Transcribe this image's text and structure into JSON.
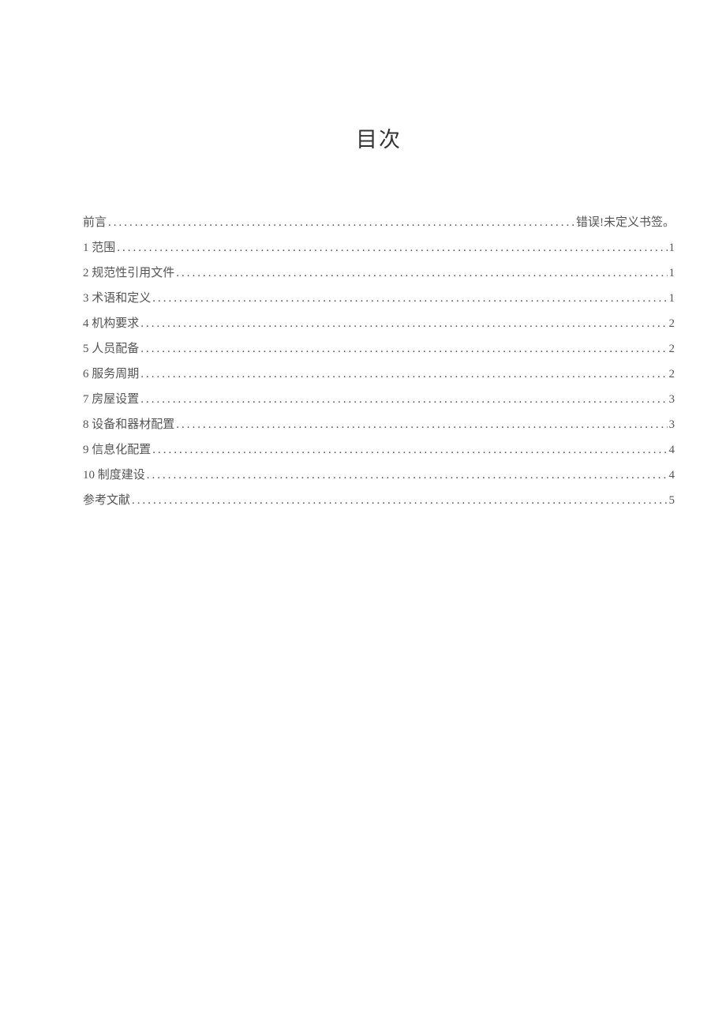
{
  "title": "目次",
  "toc": [
    {
      "label": "前言",
      "page": "错误!未定义书签。"
    },
    {
      "label": "1 范围",
      "page": "1"
    },
    {
      "label": "2 规范性引用文件",
      "page": "1"
    },
    {
      "label": "3 术语和定义",
      "page": "1"
    },
    {
      "label": "4 机构要求",
      "page": "2"
    },
    {
      "label": "5 人员配备",
      "page": "2"
    },
    {
      "label": "6 服务周期",
      "page": "2"
    },
    {
      "label": "7 房屋设置",
      "page": "3"
    },
    {
      "label": "8 设备和器材配置",
      "page": "3"
    },
    {
      "label": "9 信息化配置",
      "page": "4"
    },
    {
      "label": "10 制度建设",
      "page": "4"
    },
    {
      "label": "参考文献",
      "page": "5"
    }
  ]
}
